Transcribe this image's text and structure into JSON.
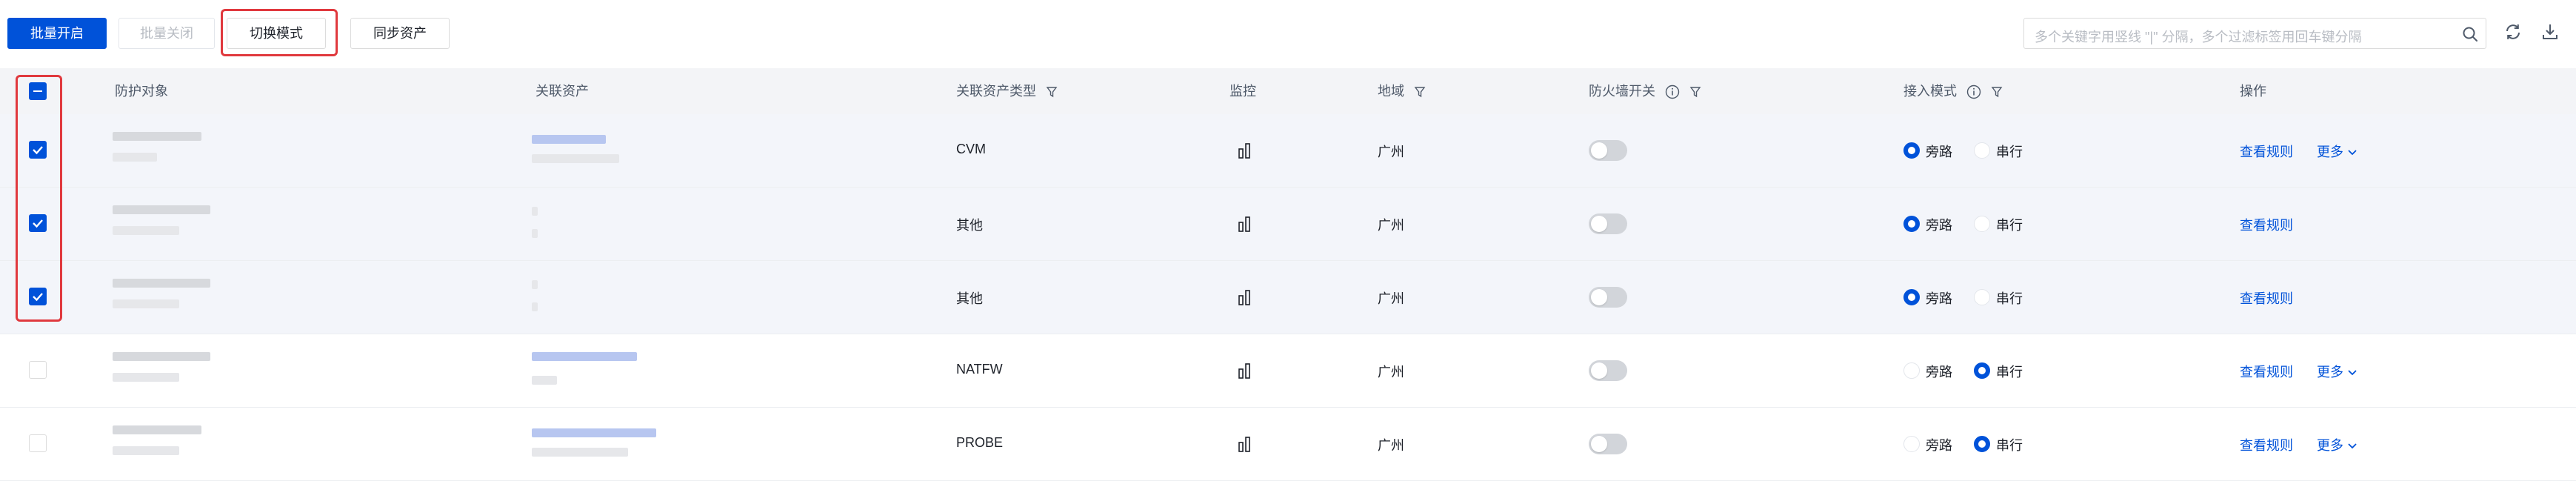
{
  "toolbar": {
    "batch_enable": "批量开启",
    "batch_disable": "批量关闭",
    "switch_mode": "切换模式",
    "sync_assets": "同步资产"
  },
  "search": {
    "placeholder": "多个关键字用竖线 \"|\" 分隔，多个过滤标签用回车键分隔"
  },
  "columns": {
    "protect_object": "防护对象",
    "linked_asset": "关联资产",
    "asset_type": "关联资产类型",
    "monitor": "监控",
    "region": "地域",
    "firewall_switch": "防火墙开关",
    "access_mode": "接入模式",
    "actions": "操作"
  },
  "rows": [
    {
      "selected": true,
      "asset_type": "CVM",
      "region": "广州",
      "firewall_on": false,
      "mode": "bypass",
      "bypass": "旁路",
      "serial": "串行",
      "view": "查看规则",
      "more": "更多"
    },
    {
      "selected": true,
      "asset_type": "其他",
      "region": "广州",
      "firewall_on": false,
      "mode": "bypass",
      "bypass": "旁路",
      "serial": "串行",
      "view": "查看规则",
      "more": ""
    },
    {
      "selected": true,
      "asset_type": "其他",
      "region": "广州",
      "firewall_on": false,
      "mode": "bypass",
      "bypass": "旁路",
      "serial": "串行",
      "view": "查看规则",
      "more": ""
    },
    {
      "selected": false,
      "asset_type": "NATFW",
      "region": "广州",
      "firewall_on": false,
      "mode": "serial",
      "bypass": "旁路",
      "serial": "串行",
      "view": "查看规则",
      "more": "更多"
    },
    {
      "selected": false,
      "asset_type": "PROBE",
      "region": "广州",
      "firewall_on": false,
      "mode": "serial",
      "bypass": "旁路",
      "serial": "串行",
      "view": "查看规则",
      "more": "更多"
    }
  ],
  "colors": {
    "primary": "#0052d9",
    "highlight": "#e0393e"
  }
}
